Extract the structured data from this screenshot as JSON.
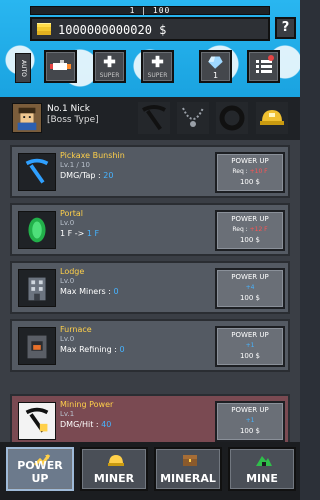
{
  "top": {
    "xp_label": "1 | 100",
    "money": "1000000000020 $",
    "help": "?",
    "auto": "AUTO",
    "super1": "SUPER",
    "super2": "SUPER",
    "gem_count": "1"
  },
  "player": {
    "name": "No.1 Nick",
    "type": "[Boss Type]"
  },
  "cards": [
    {
      "title": "Pickaxe Bunshin",
      "level": "Lv.1 / 10",
      "desc_label": "DMG/Tap : ",
      "desc_value": "20",
      "btn": {
        "title": "POWER UP",
        "req_label": "Req : ",
        "req_value": "+10 F",
        "cost": "100 $"
      }
    },
    {
      "title": "Portal",
      "level": "Lv.0",
      "desc_label": "1 F -> ",
      "desc_value": "1 F",
      "btn": {
        "title": "POWER UP",
        "req_label": "Req : ",
        "req_value": "+12 F",
        "cost": "100 $"
      }
    },
    {
      "title": "Lodge",
      "level": "Lv.0",
      "desc_label": "Max Miners : ",
      "desc_value": "0",
      "btn": {
        "title": "POWER UP",
        "req_label": "",
        "req_value": "+4",
        "cost": "100 $"
      }
    },
    {
      "title": "Furnace",
      "level": "Lv.0",
      "desc_label": "Max Refining : ",
      "desc_value": "0",
      "btn": {
        "title": "POWER UP",
        "req_label": "",
        "req_value": "+1",
        "cost": "100 $"
      }
    },
    {
      "title": "Mining Power",
      "level": "Lv.1",
      "desc_label": "DMG/Hit : ",
      "desc_value": "40",
      "btn": {
        "title": "POWER UP",
        "req_label": "",
        "req_value": "+1",
        "cost": "100 $"
      }
    }
  ],
  "tabs": [
    "POWER UP",
    "MINER",
    "MINERAL",
    "MINE"
  ],
  "colors": {
    "sky": "#29b6f0",
    "gold": "#ffd04a",
    "blue_value": "#46b3ff",
    "red_value": "#ff5353",
    "card_bg": "#545a63",
    "card_red": "#7a4a52"
  }
}
